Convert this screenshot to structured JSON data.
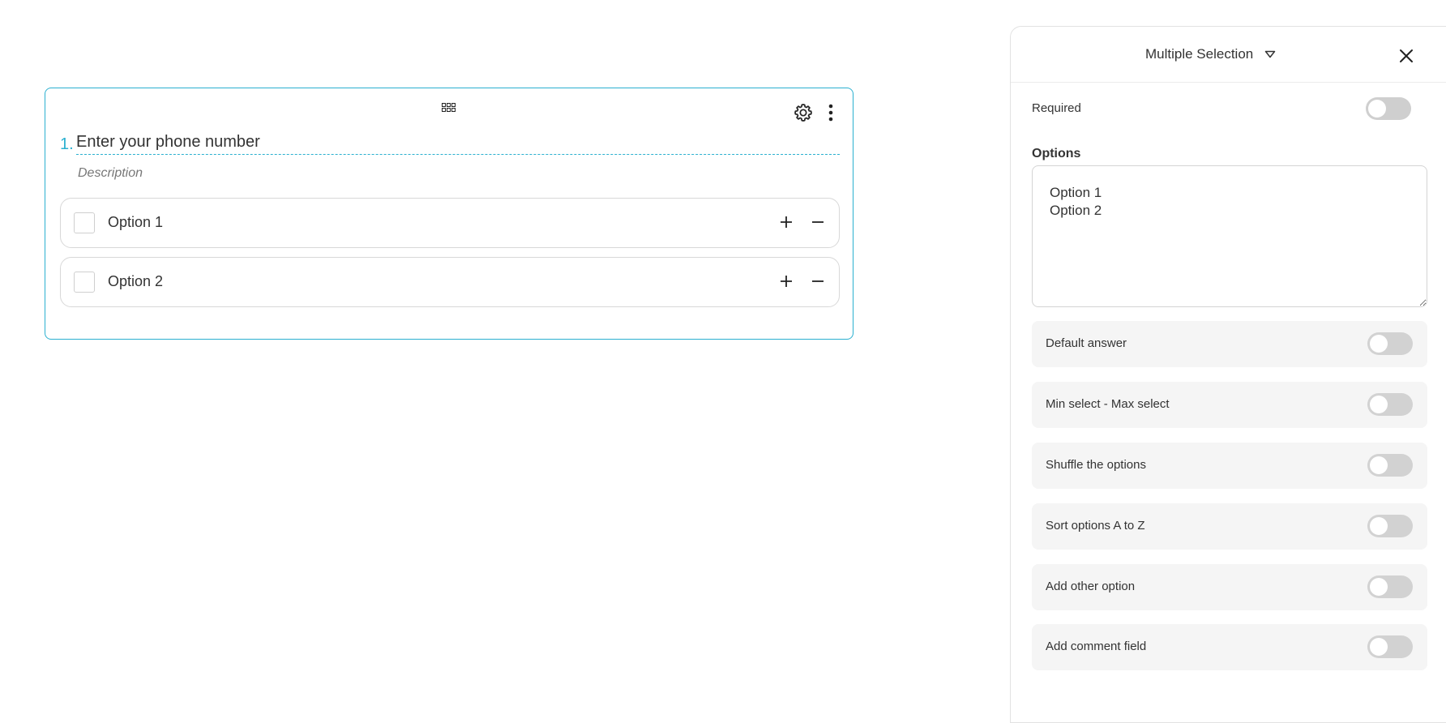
{
  "question": {
    "number": "1.",
    "title": "Enter your phone number",
    "description": "Description",
    "options": [
      {
        "label": "Option 1"
      },
      {
        "label": "Option 2"
      }
    ]
  },
  "panel": {
    "question_type": "Multiple Selection",
    "required_label": "Required",
    "options_heading": "Options",
    "options_text": "Option 1\nOption 2",
    "settings": [
      {
        "label": "Default answer",
        "enabled": false
      },
      {
        "label": "Min select - Max select",
        "enabled": false
      },
      {
        "label": "Shuffle the options",
        "enabled": false
      },
      {
        "label": "Sort options A to Z",
        "enabled": false
      },
      {
        "label": "Add other option",
        "enabled": false
      },
      {
        "label": "Add comment field",
        "enabled": false
      }
    ],
    "required_enabled": false
  },
  "colors": {
    "accent": "#2bb0d0",
    "toggle_off": "#d2d2d2",
    "row_bg": "#f5f5f5"
  },
  "icons": [
    "drag-handle-icon",
    "gear-icon",
    "more-vertical-icon",
    "plus-icon",
    "minus-icon",
    "dropdown-triangle-icon",
    "close-icon",
    "resize-grip-icon"
  ]
}
